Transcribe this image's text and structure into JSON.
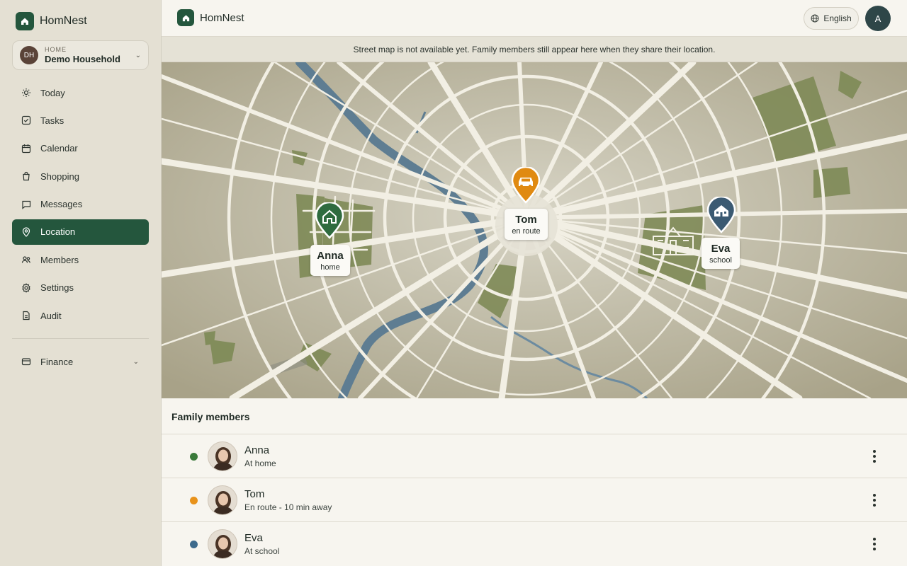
{
  "app": {
    "name": "HomNest"
  },
  "household": {
    "initials": "DH",
    "label": "HOME",
    "name": "Demo Household"
  },
  "nav": {
    "items": [
      {
        "label": "Today",
        "icon": "sun-icon"
      },
      {
        "label": "Tasks",
        "icon": "check-square-icon"
      },
      {
        "label": "Calendar",
        "icon": "calendar-icon"
      },
      {
        "label": "Shopping",
        "icon": "shopping-bag-icon"
      },
      {
        "label": "Messages",
        "icon": "message-icon"
      },
      {
        "label": "Location",
        "icon": "location-pin-icon",
        "active": true
      },
      {
        "label": "Members",
        "icon": "users-icon"
      },
      {
        "label": "Settings",
        "icon": "gear-icon"
      },
      {
        "label": "Audit",
        "icon": "document-icon"
      }
    ],
    "finance": {
      "label": "Finance",
      "icon": "wallet-icon"
    }
  },
  "header": {
    "title": "HomNest",
    "language": "English",
    "user_initial": "A"
  },
  "notice": "Street map is not available yet. Family members still appear here when they share their location.",
  "map": {
    "markers": [
      {
        "name": "Anna",
        "status": "home",
        "icon": "house-icon",
        "color": "#2f6b3f"
      },
      {
        "name": "Tom",
        "status": "en route",
        "icon": "car-icon",
        "color": "#e08a12"
      },
      {
        "name": "Eva",
        "status": "school",
        "icon": "school-icon",
        "color": "#3b5a72"
      }
    ]
  },
  "members": {
    "title": "Family members",
    "list": [
      {
        "name": "Anna",
        "status": "At home",
        "color": "#3a7a3a"
      },
      {
        "name": "Tom",
        "status": "En route - 10 min away",
        "color": "#e8921a"
      },
      {
        "name": "Eva",
        "status": "At school",
        "color": "#3d6a8c"
      }
    ]
  }
}
